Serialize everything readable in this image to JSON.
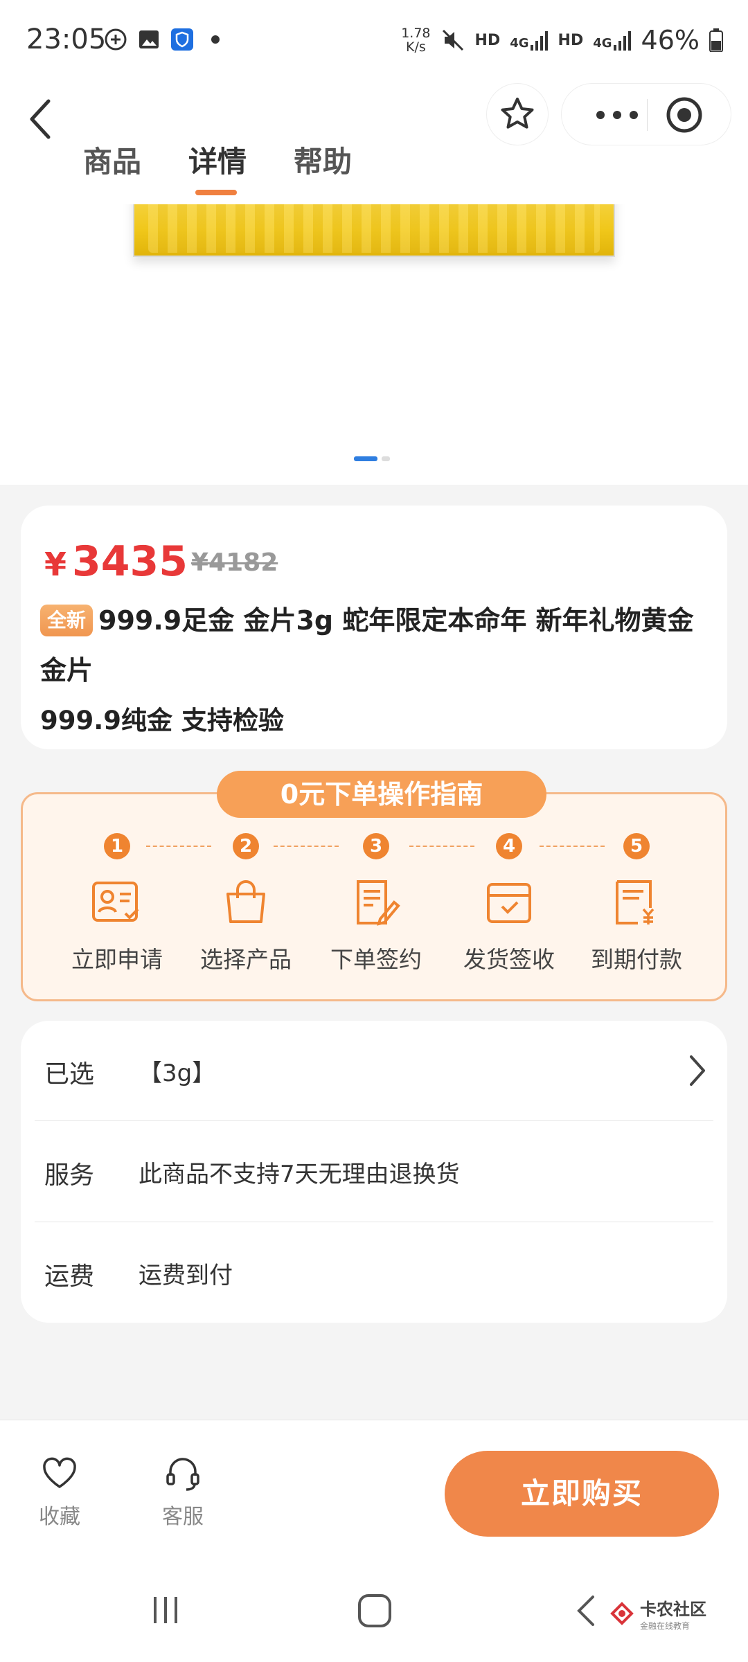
{
  "status_bar": {
    "time": "23:05",
    "net_speed_top": "1.78",
    "net_speed_bottom": "K/s",
    "battery": "46%",
    "hd1": "HD",
    "sig1": "4G",
    "hd2": "HD",
    "sig2": "4G"
  },
  "header": {
    "tabs": [
      "商品",
      "详情",
      "帮助"
    ],
    "active_tab": "详情"
  },
  "product": {
    "price_currency": "¥",
    "price": "3435",
    "original_price": "¥4182",
    "badge": "全新",
    "title": "999.9足金 金片3g 蛇年限定本命年 新年礼物黄金金片",
    "subtitle": "999.9纯金 支持检验"
  },
  "guide": {
    "title": "0元下单操作指南",
    "steps": [
      {
        "num": "1",
        "label": "立即申请",
        "icon": "id-card-icon"
      },
      {
        "num": "2",
        "label": "选择产品",
        "icon": "shopping-bag-icon"
      },
      {
        "num": "3",
        "label": "下单签约",
        "icon": "sign-document-icon"
      },
      {
        "num": "4",
        "label": "发货签收",
        "icon": "package-check-icon"
      },
      {
        "num": "5",
        "label": "到期付款",
        "icon": "invoice-yen-icon"
      }
    ]
  },
  "selection": {
    "selected_label": "已选",
    "selected_value": "【3g】",
    "service_label": "服务",
    "service_value": "此商品不支持7天无理由退换货",
    "shipping_label": "运费",
    "shipping_value": "运费到付"
  },
  "action_bar": {
    "favorite_label": "收藏",
    "service_label": "客服",
    "buy_label": "立即购买"
  },
  "watermark": {
    "name": "卡农社区",
    "tagline": "金融在线教育"
  },
  "colors": {
    "accent": "#f0874a",
    "price_red": "#e83838",
    "active_dot": "#2f7ee0"
  }
}
